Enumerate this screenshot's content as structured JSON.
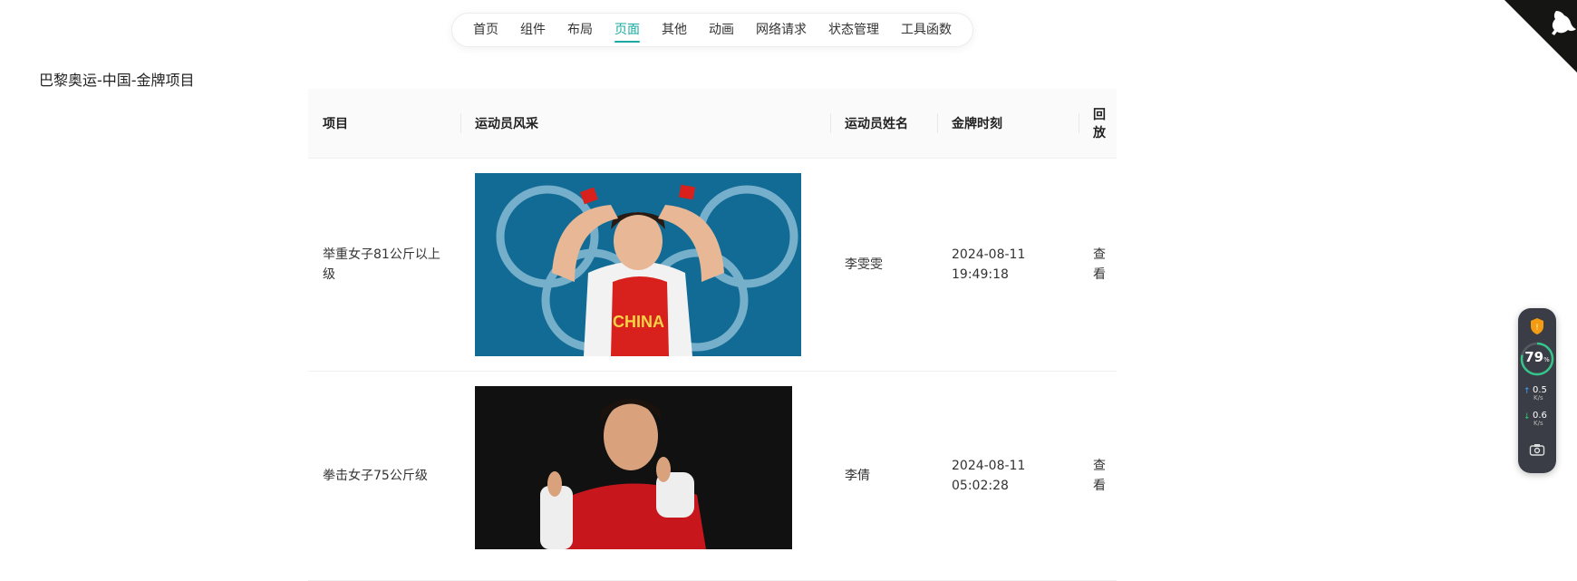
{
  "nav": {
    "items": [
      {
        "label": "首页"
      },
      {
        "label": "组件"
      },
      {
        "label": "布局"
      },
      {
        "label": "页面",
        "active": true
      },
      {
        "label": "其他"
      },
      {
        "label": "动画"
      },
      {
        "label": "网络请求"
      },
      {
        "label": "状态管理"
      },
      {
        "label": "工具函数"
      }
    ]
  },
  "page": {
    "title": "巴黎奥运-中国-金牌项目"
  },
  "table": {
    "columns": [
      "项目",
      "运动员风采",
      "运动员姓名",
      "金牌时刻",
      "回放"
    ],
    "rows": [
      {
        "event": "举重女子81公斤以上级",
        "athlete": "李雯雯",
        "time": "2024-08-11 19:49:18",
        "replay": "查看",
        "photo_text": "CHINA"
      },
      {
        "event": "拳击女子75公斤级",
        "athlete": "李倩",
        "time": "2024-08-11 05:02:28",
        "replay": "查看"
      }
    ]
  },
  "widget": {
    "percent": "79",
    "percent_unit": "%",
    "upload_value": "0.5",
    "upload_unit": "K/s",
    "download_value": "0.6",
    "download_unit": "K/s"
  },
  "colors": {
    "accent": "#1aa9a0",
    "widget_bg": "#3a3d45",
    "gauge": "#35c48a"
  },
  "icons": [
    "github-corner-icon",
    "shield-icon",
    "camera-icon"
  ]
}
